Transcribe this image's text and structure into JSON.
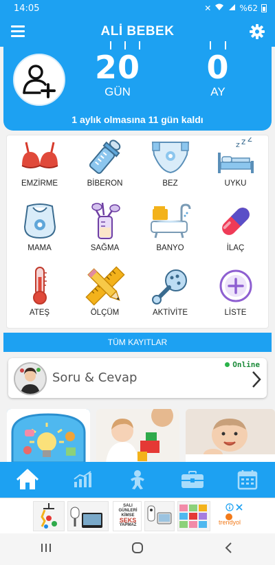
{
  "status_bar": {
    "time": "14:05",
    "signal_text": "%62"
  },
  "app_bar": {
    "title": "ALİ BEBEK"
  },
  "hero": {
    "day_count": "20",
    "day_unit": "GÜN",
    "month_count": "0",
    "month_unit": "AY",
    "message": "1 aylık olmasına 11 gün kaldı"
  },
  "categories": [
    {
      "label": "EMZİRME",
      "icon": "bra-icon"
    },
    {
      "label": "BİBERON",
      "icon": "baby-bottle-icon"
    },
    {
      "label": "BEZ",
      "icon": "diaper-icon"
    },
    {
      "label": "UYKU",
      "icon": "sleep-bed-icon"
    },
    {
      "label": "MAMA",
      "icon": "bib-icon"
    },
    {
      "label": "SAĞMA",
      "icon": "breast-pump-icon"
    },
    {
      "label": "BANYO",
      "icon": "bathtub-icon"
    },
    {
      "label": "İLAÇ",
      "icon": "pill-icon"
    },
    {
      "label": "ATEŞ",
      "icon": "thermometer-icon"
    },
    {
      "label": "ÖLÇÜM",
      "icon": "ruler-pencil-icon"
    },
    {
      "label": "AKTİVİTE",
      "icon": "rattle-icon"
    },
    {
      "label": "LİSTE",
      "icon": "plus-circle-icon"
    }
  ],
  "all_records_label": "TÜM KAYITLAR",
  "qa": {
    "title": "Soru & Cevap",
    "status": "Online"
  },
  "ad": {
    "book_line1": "SALI",
    "book_line2": "GÜNLERİ",
    "book_line3": "KİMSE",
    "book_line4": "SEKS",
    "book_line5": "YAPMAZ",
    "brand": "trendyol"
  },
  "colors": {
    "primary": "#1da1f2",
    "online_green": "#2bb34a"
  }
}
